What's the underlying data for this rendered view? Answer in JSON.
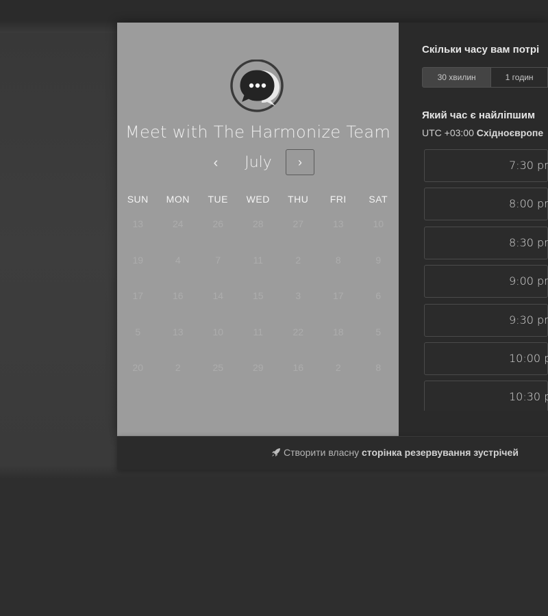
{
  "booking": {
    "title": "Meet with The Harmonize Team",
    "month": "July",
    "prev_label": "‹",
    "next_label": "›",
    "weekdays": [
      "SUN",
      "MON",
      "TUE",
      "WED",
      "THU",
      "FRI",
      "SAT"
    ],
    "days": [
      [
        "13",
        "24",
        "26",
        "28",
        "27",
        "13",
        "10"
      ],
      [
        "19",
        "4",
        "7",
        "11",
        "2",
        "8",
        "9"
      ],
      [
        "17",
        "16",
        "14",
        "15",
        "3",
        "17",
        "6"
      ],
      [
        "5",
        "13",
        "10",
        "11",
        "22",
        "18",
        "5"
      ],
      [
        "20",
        "2",
        "25",
        "29",
        "16",
        "2",
        "8"
      ]
    ]
  },
  "duration": {
    "title": "Скільки часу вам потрі",
    "options": [
      "30 хвилин",
      "1 годин"
    ],
    "selected": "30 хвилин"
  },
  "time": {
    "title": "Який час є найліпшим",
    "tz_offset": "UTC +03:00",
    "tz_name": "Східноєвропе",
    "slots": [
      "7:30 pr",
      "8:00 pr",
      "8:30 pr",
      "9:00 pr",
      "9:30 pr",
      "10:00 p",
      "10:30 p"
    ]
  },
  "footer": {
    "prefix": "Створити власну",
    "link": "сторінка резервування зустрічей"
  },
  "icons": {
    "logo": "chat-bubble-logo-icon",
    "footer": "rocket-icon"
  }
}
